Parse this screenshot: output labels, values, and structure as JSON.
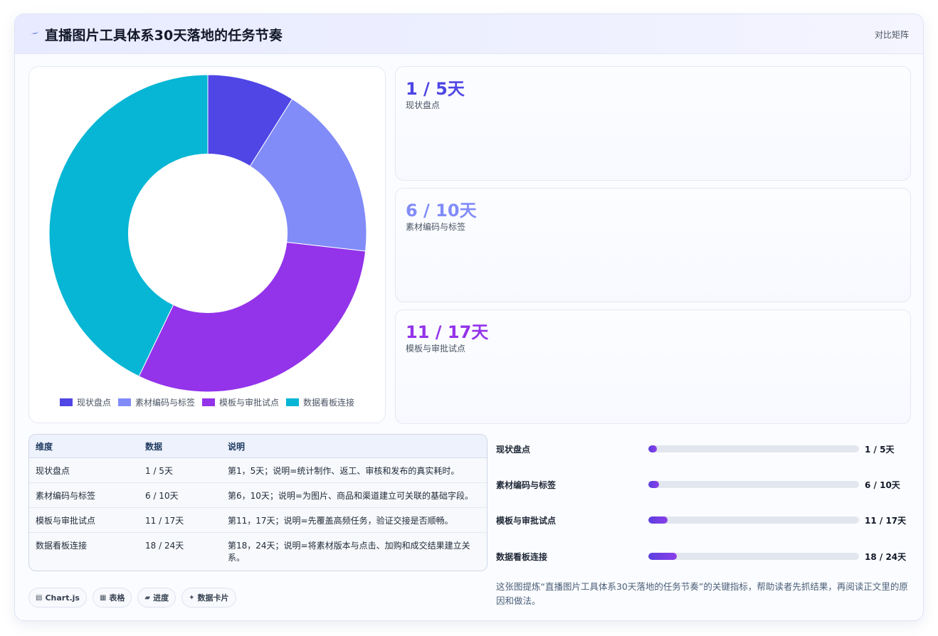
{
  "header": {
    "title": "直播图片工具体系30天落地的任务节奏",
    "compare_label": "对比矩阵",
    "icon": "bolt-icon"
  },
  "colors": {
    "indigo": "#4f46e5",
    "periwinkle": "#818cf8",
    "violet": "#9333ea",
    "cyan": "#06b6d4"
  },
  "chart_data": {
    "type": "pie",
    "categories": [
      "现状盘点",
      "素材编码与标签",
      "模板与审批试点",
      "数据看板连接"
    ],
    "values": [
      5,
      10,
      17,
      24
    ],
    "colors": [
      "#4f46e5",
      "#818cf8",
      "#9333ea",
      "#06b6d4"
    ],
    "hole": 0.5,
    "legend_position": "bottom"
  },
  "stats": [
    {
      "value": "1 / 5天",
      "label": "现状盘点",
      "color": "#4f46e5"
    },
    {
      "value": "6 / 10天",
      "label": "素材编码与标签",
      "color": "#818cf8"
    },
    {
      "value": "11 / 17天",
      "label": "模板与审批试点",
      "color": "#9333ea"
    }
  ],
  "table": {
    "headers": [
      "维度",
      "数据",
      "说明"
    ],
    "rows": [
      [
        "现状盘点",
        "1 / 5天",
        "第1，5天；说明=统计制作、返工、审核和发布的真实耗时。"
      ],
      [
        "素材编码与标签",
        "6 / 10天",
        "第6，10天；说明=为图片、商品和渠道建立可关联的基础字段。"
      ],
      [
        "模板与审批试点",
        "11 / 17天",
        "第11，17天；说明=先覆盖高频任务，验证交接是否顺畅。"
      ],
      [
        "数据看板连接",
        "18 / 24天",
        "第18，24天；说明=将素材版本与点击、加购和成交结果建立关系。"
      ]
    ]
  },
  "progress": [
    {
      "label": "现状盘点",
      "value": "1 / 5天",
      "fraction": 0.042
    },
    {
      "label": "素材编码与标签",
      "value": "6 / 10天",
      "fraction": 0.052
    },
    {
      "label": "模板与审批试点",
      "value": "11 / 17天",
      "fraction": 0.09
    },
    {
      "label": "数据看板连接",
      "value": "18 / 24天",
      "fraction": 0.135
    }
  ],
  "summary": "这张图提炼“直播图片工具体系30天落地的任务节奏”的关键指标，帮助读者先抓结果，再阅读正文里的原因和做法。",
  "chips": [
    {
      "icon": "chart-icon",
      "glyph": "▤",
      "label": "Chart.js"
    },
    {
      "icon": "table-icon",
      "glyph": "▦",
      "label": "表格"
    },
    {
      "icon": "progress-icon",
      "glyph": "▰",
      "label": "进度"
    },
    {
      "icon": "card-icon",
      "glyph": "✦",
      "label": "数据卡片"
    }
  ]
}
